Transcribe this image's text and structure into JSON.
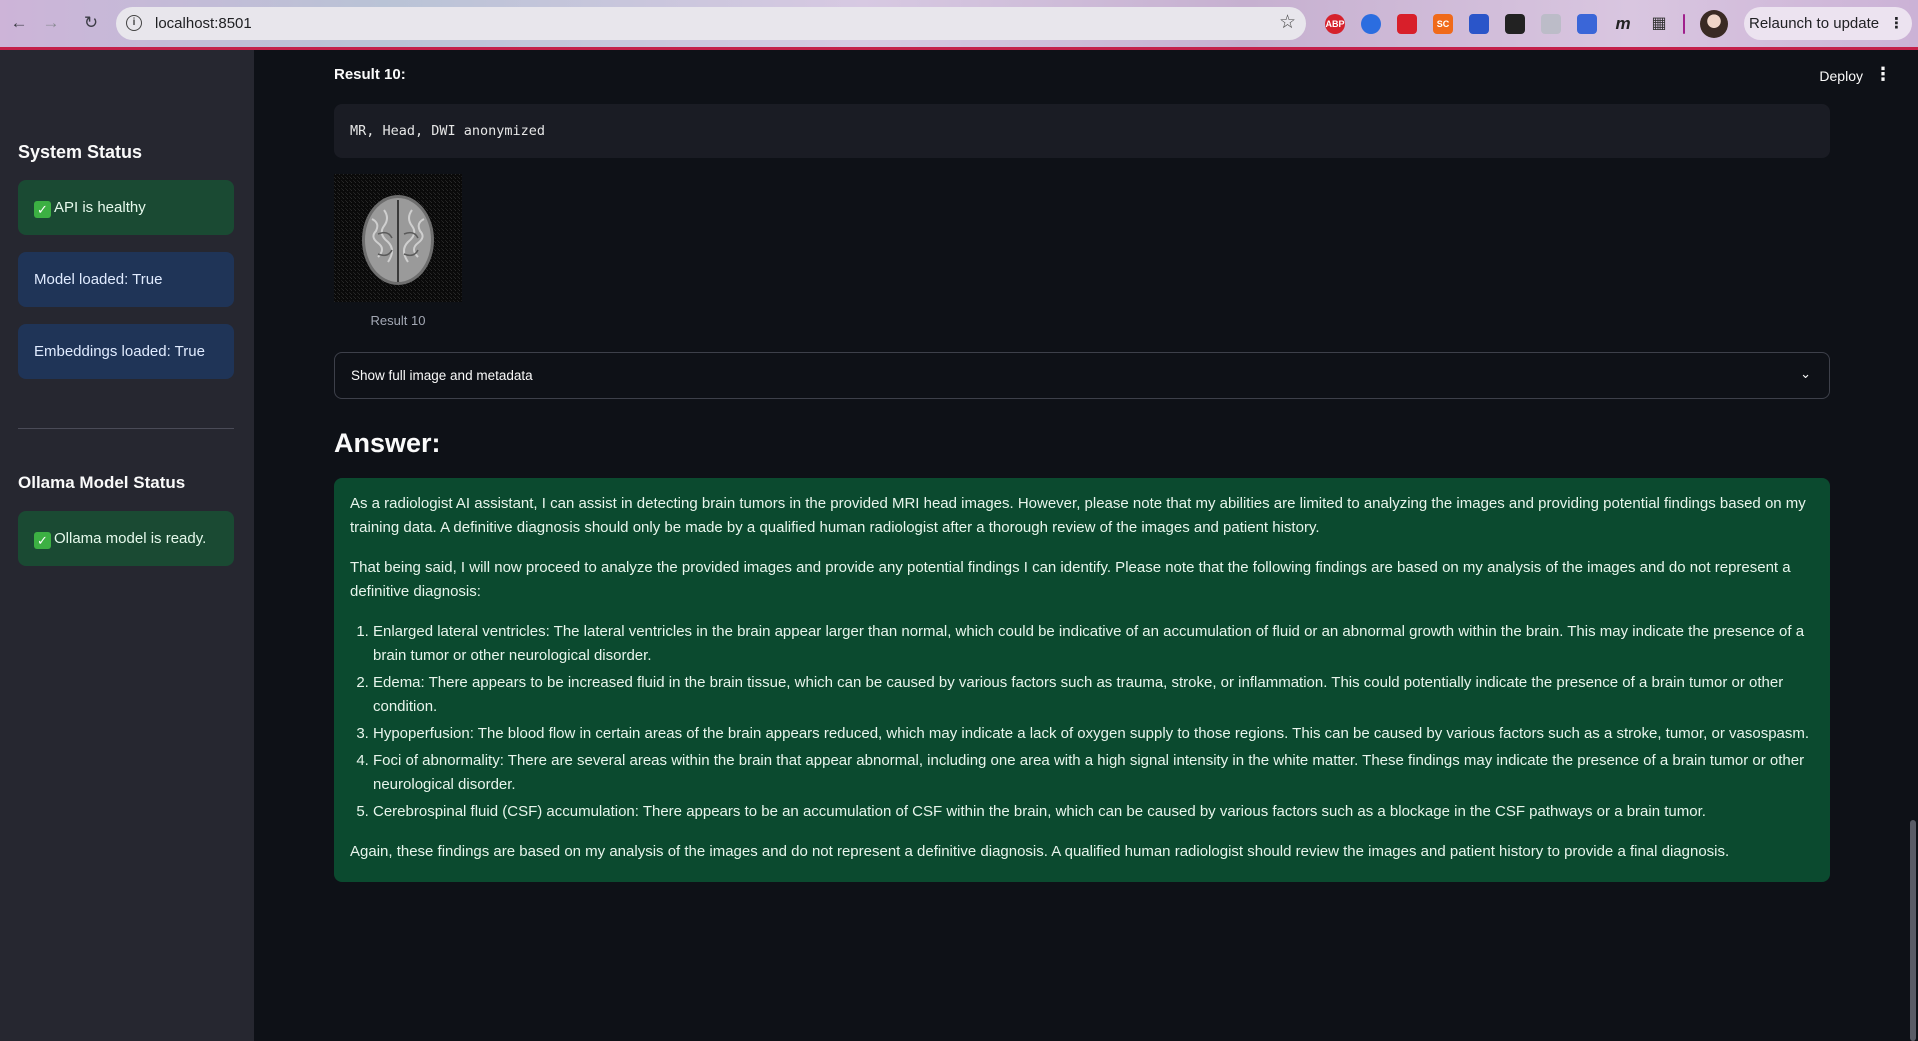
{
  "browser": {
    "url": "localhost:8501",
    "relaunch_label": "Relaunch to update",
    "ext_abp": "ABP",
    "ext_sc": "SC"
  },
  "sidebar": {
    "system_status_heading": "System Status",
    "api_status": "API is healthy",
    "model_loaded": "Model loaded: True",
    "embeddings_loaded": "Embeddings loaded: True",
    "ollama_heading": "Ollama Model Status",
    "ollama_status": "Ollama model is ready."
  },
  "header": {
    "deploy_label": "Deploy"
  },
  "result": {
    "title": "Result 10:",
    "code_text": "MR, Head, DWI anonymized",
    "caption": "Result 10",
    "expander_label": "Show full image and metadata"
  },
  "answer": {
    "heading": "Answer:",
    "intro": "As a radiologist AI assistant, I can assist in detecting brain tumors in the provided MRI head images. However, please note that my abilities are limited to analyzing the images and providing potential findings based on my training data. A definitive diagnosis should only be made by a qualified human radiologist after a thorough review of the images and patient history.",
    "lead": "That being said, I will now proceed to analyze the provided images and provide any potential findings I can identify. Please note that the following findings are based on my analysis of the images and do not represent a definitive diagnosis:",
    "findings": [
      "Enlarged lateral ventricles: The lateral ventricles in the brain appear larger than normal, which could be indicative of an accumulation of fluid or an abnormal growth within the brain. This may indicate the presence of a brain tumor or other neurological disorder.",
      "Edema: There appears to be increased fluid in the brain tissue, which can be caused by various factors such as trauma, stroke, or inflammation. This could potentially indicate the presence of a brain tumor or other condition.",
      "Hypoperfusion: The blood flow in certain areas of the brain appears reduced, which may indicate a lack of oxygen supply to those regions. This can be caused by various factors such as a stroke, tumor, or vasospasm.",
      "Foci of abnormality: There are several areas within the brain that appear abnormal, including one area with a high signal intensity in the white matter. These findings may indicate the presence of a brain tumor or other neurological disorder.",
      "Cerebrospinal fluid (CSF) accumulation: There appears to be an accumulation of CSF within the brain, which can be caused by various factors such as a blockage in the CSF pathways or a brain tumor."
    ],
    "closing": "Again, these findings are based on my analysis of the images and do not represent a definitive diagnosis. A qualified human radiologist should review the images and patient history to provide a final diagnosis."
  },
  "colors": {
    "sidebar_bg": "#262730",
    "main_bg": "#0e1117",
    "success_bg": "#1a4a33",
    "info_bg": "#1f3457",
    "answer_bg": "#0b4a2f"
  }
}
